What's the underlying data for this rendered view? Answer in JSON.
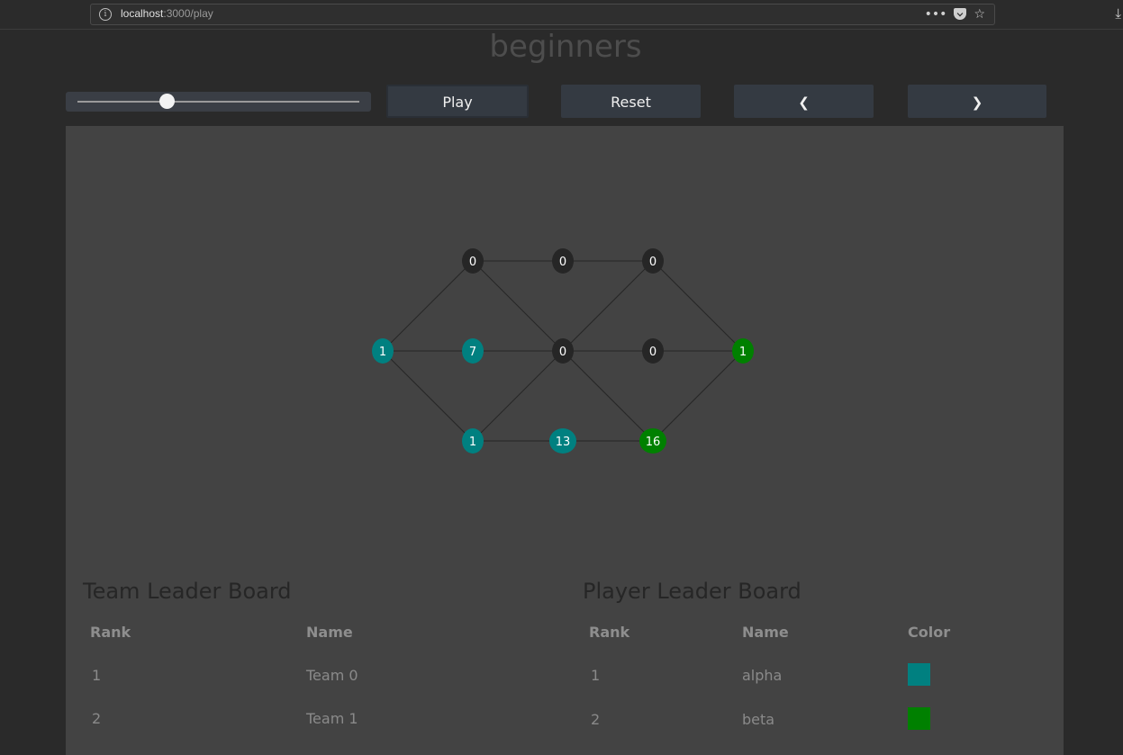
{
  "browser": {
    "url_host": "localhost",
    "url_path": ":3000/play",
    "menu_glyph": "•••",
    "bookmark_glyph": "☆",
    "download_glyph": "⤓"
  },
  "page": {
    "title": "beginners"
  },
  "controls": {
    "slider_value": 0.32,
    "play_label": "Play",
    "reset_label": "Reset",
    "prev_glyph": "❮",
    "next_glyph": "❯"
  },
  "colors": {
    "team0": "#008080",
    "team1": "#008000",
    "neutral": "#262626"
  },
  "graph": {
    "nodes": [
      {
        "id": "n00",
        "value": "0",
        "owner": "neutral"
      },
      {
        "id": "n01",
        "value": "0",
        "owner": "neutral"
      },
      {
        "id": "n02",
        "value": "0",
        "owner": "neutral"
      },
      {
        "id": "n10",
        "value": "1",
        "owner": "team0"
      },
      {
        "id": "n11",
        "value": "7",
        "owner": "team0"
      },
      {
        "id": "n12",
        "value": "0",
        "owner": "neutral"
      },
      {
        "id": "n13",
        "value": "0",
        "owner": "neutral"
      },
      {
        "id": "n14",
        "value": "1",
        "owner": "team1"
      },
      {
        "id": "n20",
        "value": "1",
        "owner": "team0"
      },
      {
        "id": "n21",
        "value": "13",
        "owner": "team0"
      },
      {
        "id": "n22",
        "value": "16",
        "owner": "team1"
      }
    ],
    "edges": [
      [
        "n00",
        "n01"
      ],
      [
        "n01",
        "n02"
      ],
      [
        "n10",
        "n11"
      ],
      [
        "n11",
        "n12"
      ],
      [
        "n12",
        "n13"
      ],
      [
        "n13",
        "n14"
      ],
      [
        "n20",
        "n21"
      ],
      [
        "n21",
        "n22"
      ],
      [
        "n10",
        "n00"
      ],
      [
        "n10",
        "n20"
      ],
      [
        "n00",
        "n12"
      ],
      [
        "n02",
        "n12"
      ],
      [
        "n20",
        "n12"
      ],
      [
        "n12",
        "n22"
      ],
      [
        "n02",
        "n14"
      ],
      [
        "n22",
        "n14"
      ]
    ]
  },
  "team_board": {
    "title": "Team Leader Board",
    "headers": [
      "Rank",
      "Name"
    ],
    "rows": [
      {
        "rank": "1",
        "name": "Team 0"
      },
      {
        "rank": "2",
        "name": "Team 1"
      }
    ]
  },
  "player_board": {
    "title": "Player Leader Board",
    "headers": [
      "Rank",
      "Name",
      "Color"
    ],
    "rows": [
      {
        "rank": "1",
        "name": "alpha",
        "color": "#008080"
      },
      {
        "rank": "2",
        "name": "beta",
        "color": "#008000"
      }
    ]
  }
}
